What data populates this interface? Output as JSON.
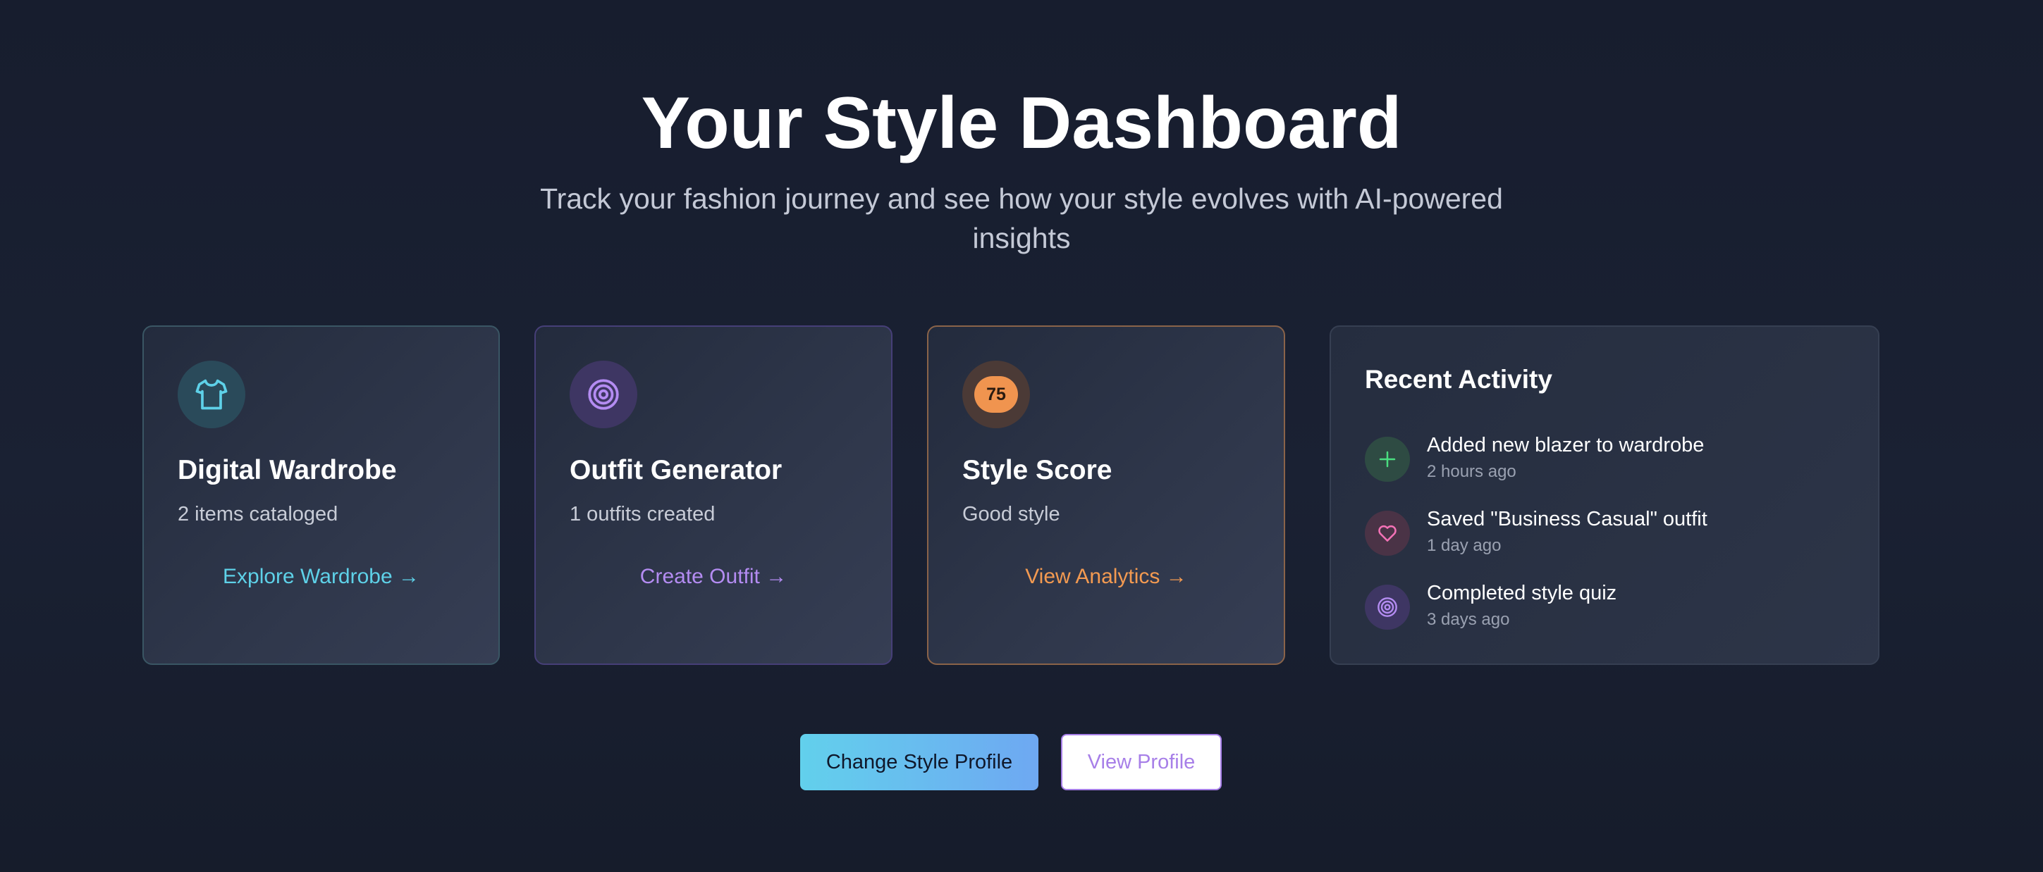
{
  "header": {
    "title": "Your Style Dashboard",
    "subtitle": "Track your fashion journey and see how your style evolves with AI-powered insights"
  },
  "cards": [
    {
      "icon": "shirt-icon",
      "title": "Digital Wardrobe",
      "subtitle": "2 items cataloged",
      "link": "Explore Wardrobe →",
      "accent": "#5ed1e8"
    },
    {
      "icon": "target-icon",
      "title": "Outfit Generator",
      "subtitle": "1 outfits created",
      "link": "Create Outfit →",
      "accent": "#b48cf2"
    },
    {
      "icon": "score-badge",
      "score": "75",
      "title": "Style Score",
      "subtitle": "Good style",
      "link": "View Analytics →",
      "accent": "#f39a51"
    }
  ],
  "activity": {
    "title": "Recent Activity",
    "items": [
      {
        "icon": "plus-icon",
        "text": "Added new blazer to wardrobe",
        "time": "2 hours ago",
        "color": "#4ade80"
      },
      {
        "icon": "heart-icon",
        "text": "Saved \"Business Casual\" outfit",
        "time": "1 day ago",
        "color": "#f472b6"
      },
      {
        "icon": "target-icon",
        "text": "Completed style quiz",
        "time": "3 days ago",
        "color": "#b48cf2"
      }
    ]
  },
  "actions": {
    "primary_label": "Change Style Profile",
    "secondary_label": "View Profile"
  }
}
